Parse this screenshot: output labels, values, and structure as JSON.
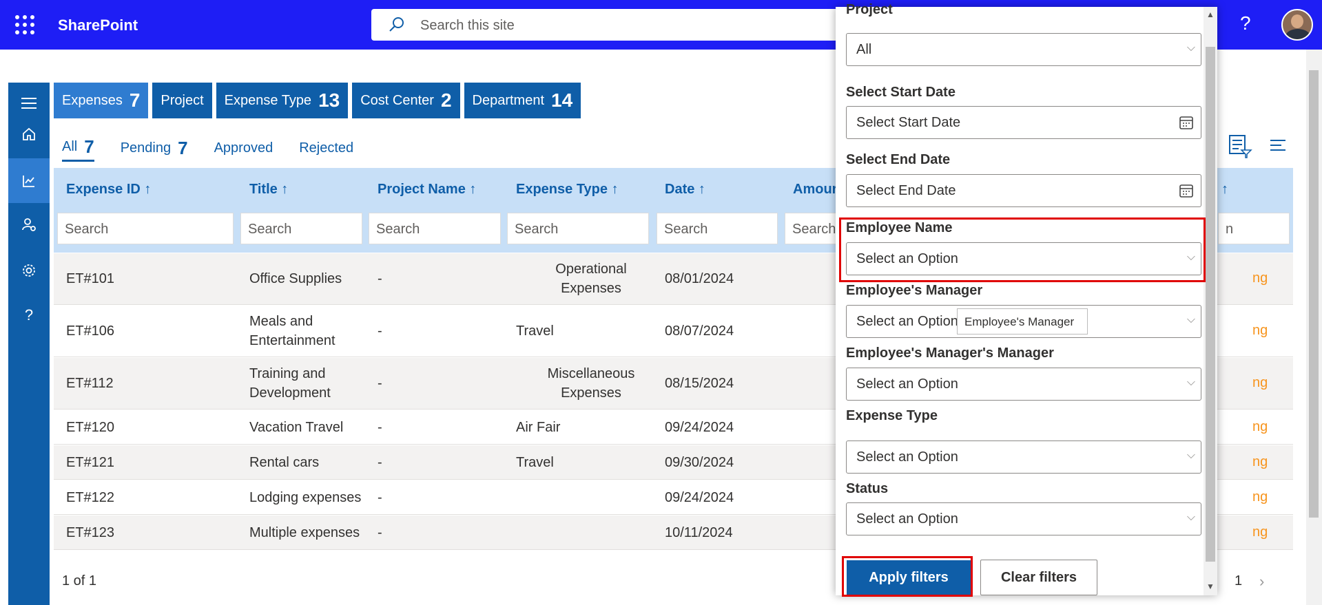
{
  "app": {
    "brand": "SharePoint",
    "search_placeholder": "Search this site",
    "help": "?"
  },
  "main_tabs": [
    {
      "label": "Expenses",
      "count": "7"
    },
    {
      "label": "Project",
      "count": ""
    },
    {
      "label": "Expense Type",
      "count": "13"
    },
    {
      "label": "Cost Center",
      "count": "2"
    },
    {
      "label": "Department",
      "count": "14"
    }
  ],
  "sub_tabs": [
    {
      "label": "All",
      "count": "7"
    },
    {
      "label": "Pending",
      "count": "7"
    },
    {
      "label": "Approved",
      "count": ""
    },
    {
      "label": "Rejected",
      "count": ""
    }
  ],
  "table": {
    "headers": [
      "Expense ID ↑",
      "Title ↑",
      "Project Name ↑",
      "Expense Type ↑",
      "Date ↑",
      "Amour",
      "↑"
    ],
    "search_placeholder": "Search",
    "search_partial": "n",
    "rows": [
      {
        "id": "ET#101",
        "title": "Office Supplies",
        "project": "-",
        "type": "Operational Expenses",
        "date": "08/01/2024",
        "status": "ng"
      },
      {
        "id": "ET#106",
        "title": "Meals and Entertainment",
        "project": "-",
        "type": "Travel",
        "date": "08/07/2024",
        "status": "ng"
      },
      {
        "id": "ET#112",
        "title": "Training and Development",
        "project": "-",
        "type": "Miscellaneous Expenses",
        "date": "08/15/2024",
        "status": "ng"
      },
      {
        "id": "ET#120",
        "title": "Vacation Travel",
        "project": "-",
        "type": "Air Fair",
        "date": "09/24/2024",
        "status": "ng"
      },
      {
        "id": "ET#121",
        "title": "Rental cars",
        "project": "-",
        "type": "Travel",
        "date": "09/30/2024",
        "status": "ng"
      },
      {
        "id": "ET#122",
        "title": "Lodging expenses",
        "project": "-",
        "type": "",
        "date": "09/24/2024",
        "status": "ng"
      },
      {
        "id": "ET#123",
        "title": "Multiple expenses",
        "project": "-",
        "type": "",
        "date": "10/11/2024",
        "status": "ng"
      }
    ],
    "page_info": "1 of 1",
    "page_number": "1"
  },
  "filter_panel": {
    "project_label": "Project",
    "project_value": "All",
    "start_label": "Select Start Date",
    "start_placeholder": "Select Start Date",
    "end_label": "Select End Date",
    "end_placeholder": "Select End Date",
    "employee_label": "Employee Name",
    "employee_value": "Select an Option",
    "manager_label": "Employee's Manager",
    "manager_value": "Select an Option",
    "manager_tooltip": "Employee's Manager",
    "managers_manager_label": "Employee's Manager's Manager",
    "managers_manager_value": "Select an Option",
    "expense_type_label": "Expense Type",
    "expense_type_value": "Select an Option",
    "status_label": "Status",
    "status_value": "Select an Option",
    "apply_label": "Apply filters",
    "clear_label": "Clear filters"
  },
  "colors": {
    "brand_bar": "#1e1ef5",
    "nav": "#0f5ea8",
    "nav_active": "#2f7cd0",
    "header_bg": "#c7dff7",
    "pending": "#f7941d",
    "highlight": "#e00000"
  }
}
